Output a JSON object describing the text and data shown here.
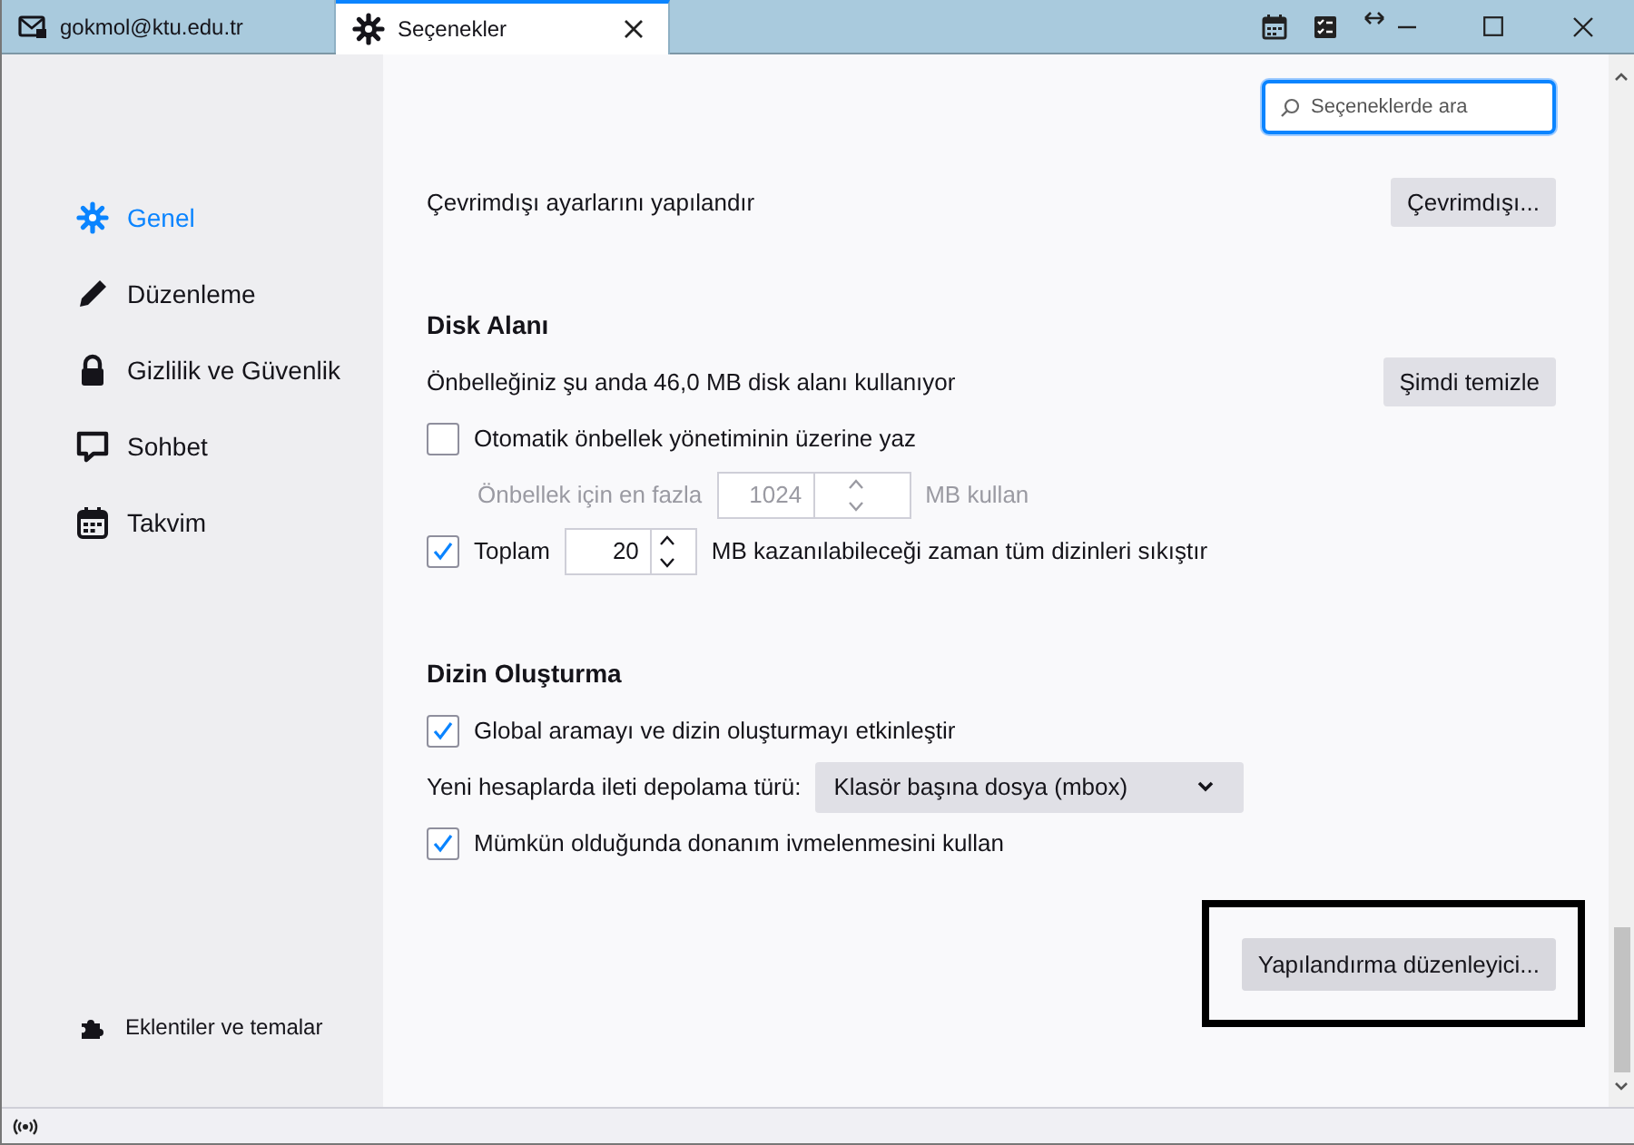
{
  "tabs": [
    {
      "label": "gokmol@ktu.edu.tr",
      "selected": false
    },
    {
      "label": "Seçenekler",
      "selected": true
    }
  ],
  "search": {
    "placeholder": "Seçeneklerde ara"
  },
  "sidebar": {
    "items": [
      {
        "label": "Genel",
        "selected": true
      },
      {
        "label": "Düzenleme",
        "selected": false
      },
      {
        "label": "Gizlilik ve Güvenlik",
        "selected": false
      },
      {
        "label": "Sohbet",
        "selected": false
      },
      {
        "label": "Takvim",
        "selected": false
      }
    ],
    "footer": {
      "label": "Eklentiler ve temalar"
    }
  },
  "sections": [
    {
      "rows": [
        {
          "kind": "text_button",
          "text": "Çevrimdışı ayarlarını yapılandır",
          "button": "Çevrimdışı..."
        }
      ]
    },
    {
      "heading": "Disk Alanı",
      "rows": [
        {
          "kind": "text_button",
          "text": "Önbelleğiniz şu anda 46,0 MB disk alanı kullanıyor",
          "button": "Şimdi temizle"
        },
        {
          "kind": "checkbox",
          "label": "Otomatik önbellek yönetiminin üzerine yaz",
          "checked": false
        },
        {
          "kind": "spinner",
          "before": "Önbellek için en fazla",
          "value": "1024",
          "after": "MB kullan",
          "disabled": true
        },
        {
          "kind": "checkbox_spinner",
          "before": "Toplam",
          "value": "20",
          "after": "MB kazanılabileceği zaman tüm dizinleri sıkıştır",
          "checked": true
        }
      ]
    },
    {
      "heading": "Dizin Oluşturma",
      "rows": [
        {
          "kind": "checkbox",
          "label": "Global aramayı ve dizin oluşturmayı etkinleştir",
          "checked": true
        },
        {
          "kind": "select",
          "label": "Yeni hesaplarda ileti depolama türü:",
          "value": "Klasör başına dosya (mbox)"
        },
        {
          "kind": "checkbox",
          "label": "Mümkün olduğunda donanım ivmelenmesini kullan",
          "checked": true
        }
      ]
    }
  ],
  "footer_button": {
    "label": "Yapılandırma düzenleyici...",
    "highlighted": true
  }
}
